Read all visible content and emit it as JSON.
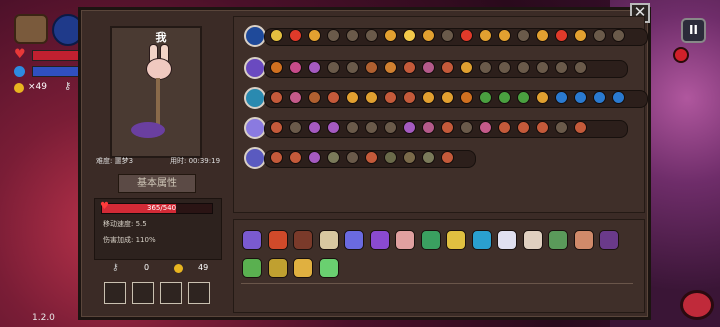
{
  "hud": {
    "coins_text": "×49",
    "chest_icon": "chest-icon",
    "weapon_icon": "wand-icon"
  },
  "version": "1.2.0",
  "buttons": {
    "close_label": "✕",
    "pause_label": "II"
  },
  "character": {
    "name": "我",
    "difficulty": "难度: 噩梦3",
    "time": "用时: 00:39:19",
    "tab_label": "基本属性"
  },
  "stats": {
    "hp_text": "365/540",
    "hp_fraction": 0.676,
    "move_speed": "移动速度: 5.5",
    "damage_bonus": "伤害加成: 110%"
  },
  "resources": {
    "keys": "0",
    "coins": "49"
  },
  "wand_rows": [
    {
      "name": "wand-row-1",
      "lead_color": "#1f4a9a",
      "track_width": 382,
      "spells": [
        "#e4c040",
        "#e03a2a",
        "#e2a030",
        "#6a5a4a",
        "#6a5a4a",
        "#6a5a4a",
        "#e2a030",
        "#f3c94a",
        "#e2a030",
        "#6a5a4a",
        "#e03a2a",
        "#e2a030",
        "#e2a030",
        "#6a5a4a",
        "#e2a030",
        "#e03a2a",
        "#e2a030",
        "#6a5a4a",
        "#6a5a4a"
      ]
    },
    {
      "name": "wand-row-2",
      "lead_color": "#6a4ac0",
      "track_width": 362,
      "spells": [
        "#d07020",
        "#c74b8a",
        "#a45ac0",
        "#6a5a4a",
        "#6a5a4a",
        "#b06030",
        "#d08030",
        "#c45a3a",
        "#b45a8a",
        "#c45a3a",
        "#e0a030",
        "#6a5a4a",
        "#6a5a4a",
        "#6a5a4a",
        "#6a5a4a",
        "#6a5a4a",
        "#6a5a4a"
      ]
    },
    {
      "name": "wand-row-3",
      "lead_color": "#2a8ab0",
      "track_width": 382,
      "spells": [
        "#c45a3a",
        "#c45a8a",
        "#b06030",
        "#c45a3a",
        "#e2a030",
        "#e0a030",
        "#c45a3a",
        "#c45a3a",
        "#e2a030",
        "#e2a030",
        "#d07020",
        "#4aa040",
        "#4aa040",
        "#4aa040",
        "#e0a030",
        "#2a7ad0",
        "#2a7ad0",
        "#2a7ad0",
        "#2a7ad0"
      ]
    },
    {
      "name": "wand-row-4",
      "lead_color": "#8a7ae0",
      "track_width": 362,
      "spells": [
        "#c45a3a",
        "#6a5a4a",
        "#a45ac0",
        "#a45ac0",
        "#6a5a4a",
        "#6a5a4a",
        "#6a5a4a",
        "#a45ac0",
        "#b45a8a",
        "#c45a3a",
        "#6a5a4a",
        "#c45a8a",
        "#c45a3a",
        "#c45a3a",
        "#c45a3a",
        "#6a5a4a",
        "#c45a3a"
      ]
    },
    {
      "name": "wand-row-5",
      "lead_color": "#5a5ac0",
      "track_width": 210,
      "spells": [
        "#c45a3a",
        "#c45a3a",
        "#a45ac0",
        "#7a7a5a",
        "#6a5a4a",
        "#c45a3a",
        "#6a6a4a",
        "#7a6a4a",
        "#7a7a5a",
        "#c45a3a"
      ]
    }
  ],
  "items": [
    "#7a5ad0",
    "#d04a2a",
    "#7a3a2a",
    "#d8c8a0",
    "#6a6ae0",
    "#8a4ad0",
    "#e0a0a0",
    "#3aa060",
    "#e0c040",
    "#2aa0d0",
    "#e0e0f0",
    "#e0d0c0",
    "#5a9a5a",
    "#d08a6a",
    "#6a3a8a",
    "#5ab050",
    "#c0a030",
    "#e0b040",
    "#6ad070"
  ]
}
